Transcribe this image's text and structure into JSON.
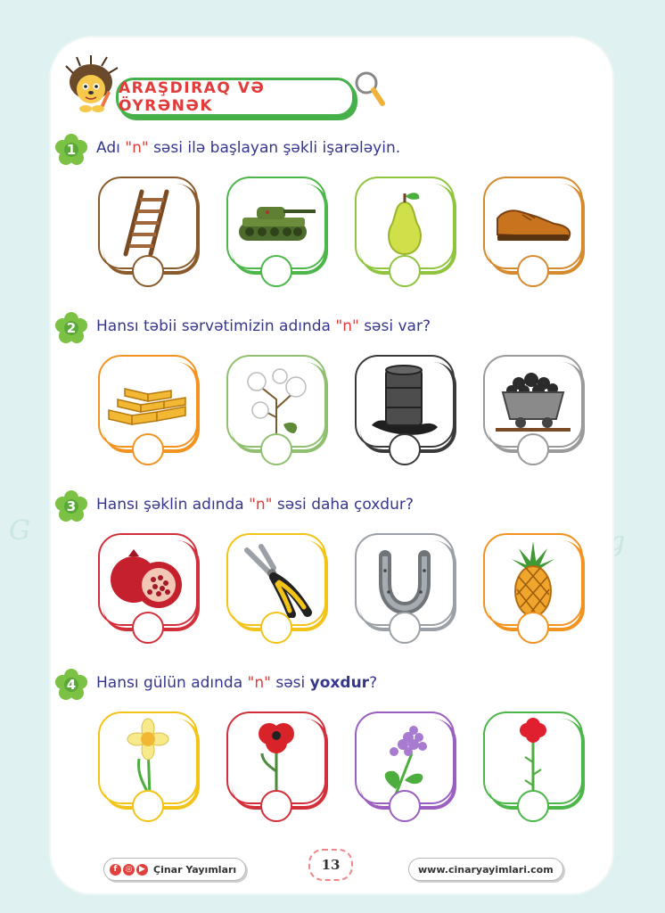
{
  "header": {
    "title": "ARAŞDIRAQ VƏ ÖYRƏNƏK"
  },
  "questions": [
    {
      "number": "1",
      "pre": "Adı ",
      "highlight": "\"n\"",
      "post": " səsi ilə başlayan şəkli işarələyin.",
      "bold": "",
      "end": ""
    },
    {
      "number": "2",
      "pre": "Hansı təbii sərvətimizin adında ",
      "highlight": "\"n\"",
      "post": " səsi var?",
      "bold": "",
      "end": ""
    },
    {
      "number": "3",
      "pre": "Hansı şəklin adında ",
      "highlight": "\"n\"",
      "post": " səsi daha çoxdur?",
      "bold": "",
      "end": ""
    },
    {
      "number": "4",
      "pre": "Hansı gülün adında ",
      "highlight": "\"n\"",
      "post": " səsi ",
      "bold": "yoxdur",
      "end": "?"
    }
  ],
  "cards": [
    [
      "ladder-icon",
      "tank-icon",
      "pear-icon",
      "shoe-icon"
    ],
    [
      "gold-bars-icon",
      "cotton-icon",
      "oil-barrel-icon",
      "coal-cart-icon"
    ],
    [
      "pomegranate-icon",
      "pliers-icon",
      "horseshoe-icon",
      "pineapple-icon"
    ],
    [
      "daffodil-icon",
      "poppy-icon",
      "lilac-icon",
      "carnation-icon"
    ]
  ],
  "colors": {
    "row1": [
      "#8a5a2b",
      "#4cb648",
      "#8fc43e",
      "#d68a2e"
    ],
    "row2": [
      "#f3931f",
      "#8fbf6f",
      "#3a3a3a",
      "#9a9a9a"
    ],
    "row3": [
      "#d32f3a",
      "#f3c318",
      "#9aa0a6",
      "#f3931f"
    ],
    "row4": [
      "#f3c318",
      "#d32f3a",
      "#9a5fc0",
      "#4cb648"
    ],
    "title_red": "#e33a3a",
    "text_blue": "#35368c",
    "flower_green": "#7bc143"
  },
  "footer": {
    "publisher": "Çinar Yayımları",
    "page": "13",
    "website": "www.cinaryayimlari.com"
  }
}
